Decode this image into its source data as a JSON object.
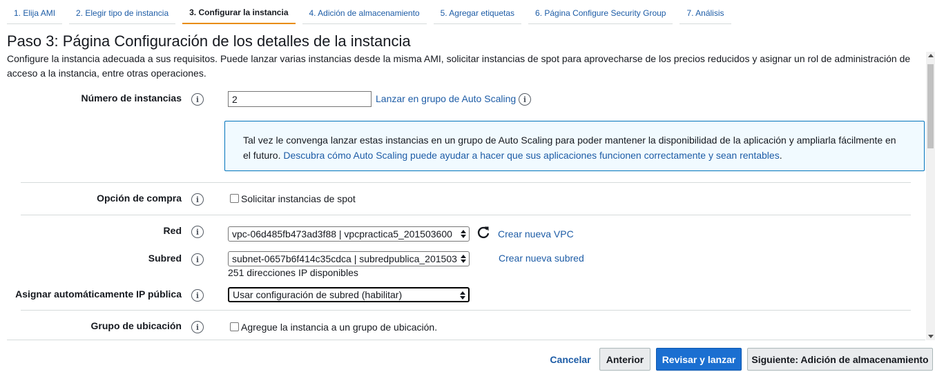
{
  "tabs": [
    {
      "label": "1. Elija AMI"
    },
    {
      "label": "2. Elegir tipo de instancia"
    },
    {
      "label": "3. Configurar la instancia"
    },
    {
      "label": "4. Adición de almacenamiento"
    },
    {
      "label": "5. Agregar etiquetas"
    },
    {
      "label": "6. Página Configure Security Group"
    },
    {
      "label": "7. Análisis"
    }
  ],
  "page": {
    "title": "Paso 3: Página Configuración de los detalles de la instancia",
    "description": "Configure la instancia adecuada a sus requisitos. Puede lanzar varias instancias desde la misma AMI, solicitar instancias de spot para aprovecharse de los precios reducidos y asignar un rol de administración de acceso a la instancia, entre otras operaciones."
  },
  "form": {
    "info_glyph": "i",
    "num_instances": {
      "label": "Número de instancias",
      "value": "2",
      "autoscaling_link": "Lanzar en grupo de Auto Scaling"
    },
    "banner": {
      "text": "Tal vez le convenga lanzar estas instancias en un grupo de Auto Scaling para poder mantener la disponibilidad de la aplicación y ampliarla fácilmente en el futuro.",
      "link": "Descubra cómo Auto Scaling puede ayudar a hacer que sus aplicaciones funcionen correctamente y sean rentables",
      "suffix": "."
    },
    "purchase": {
      "label": "Opción de compra",
      "checkbox_label": "Solicitar instancias de spot"
    },
    "network": {
      "label": "Red",
      "value": "vpc-06d485fb473ad3f88 | vpcpractica5_201503600",
      "create_link": "Crear nueva VPC"
    },
    "subnet": {
      "label": "Subred",
      "value": "subnet-0657b6f414c35cdca | subredpublica_201503",
      "available": "251 direcciones IP disponibles",
      "create_link": "Crear nueva subred"
    },
    "public_ip": {
      "label": "Asignar automáticamente IP pública",
      "value": "Usar configuración de subred (habilitar)"
    },
    "placement": {
      "label": "Grupo de ubicación",
      "checkbox_label": "Agregue la instancia a un grupo de ubicación."
    }
  },
  "footer": {
    "cancel": "Cancelar",
    "previous": "Anterior",
    "review_launch": "Revisar y lanzar",
    "next": "Siguiente: Adición de almacenamiento"
  },
  "colors": {
    "link": "#1d5ca6",
    "active_tab_underline": "#e88c00",
    "primary_button": "#1b6fd1",
    "banner_border": "#0073bb"
  }
}
